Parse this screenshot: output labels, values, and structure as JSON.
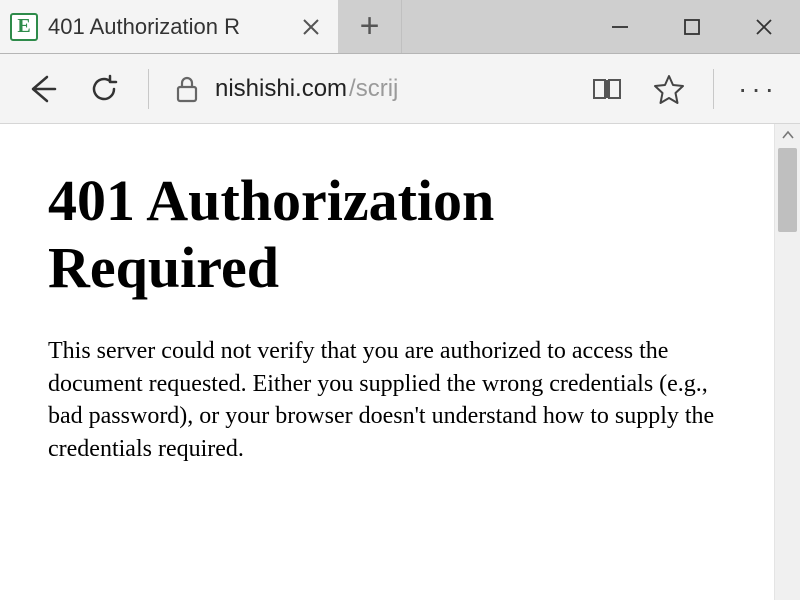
{
  "window": {
    "minimize_alt": "Minimize",
    "maximize_alt": "Maximize",
    "close_alt": "Close"
  },
  "tab": {
    "favicon_letter": "E",
    "title": "401 Authorization R",
    "close_alt": "Close tab"
  },
  "newtab": {
    "glyph": "+"
  },
  "toolbar": {
    "back_alt": "Back",
    "refresh_alt": "Refresh",
    "lock_alt": "Not secure",
    "reading_alt": "Reading view",
    "favorite_alt": "Add to favorites",
    "more_alt": "More actions",
    "more_glyph": "···"
  },
  "address": {
    "domain": "nishishi.com",
    "path": "/scrij"
  },
  "page": {
    "heading": "401 Authorization Required",
    "body": "This server could not verify that you are authorized to access the document requested. Either you supplied the wrong credentials (e.g., bad password), or your browser doesn't understand how to supply the credentials required."
  }
}
